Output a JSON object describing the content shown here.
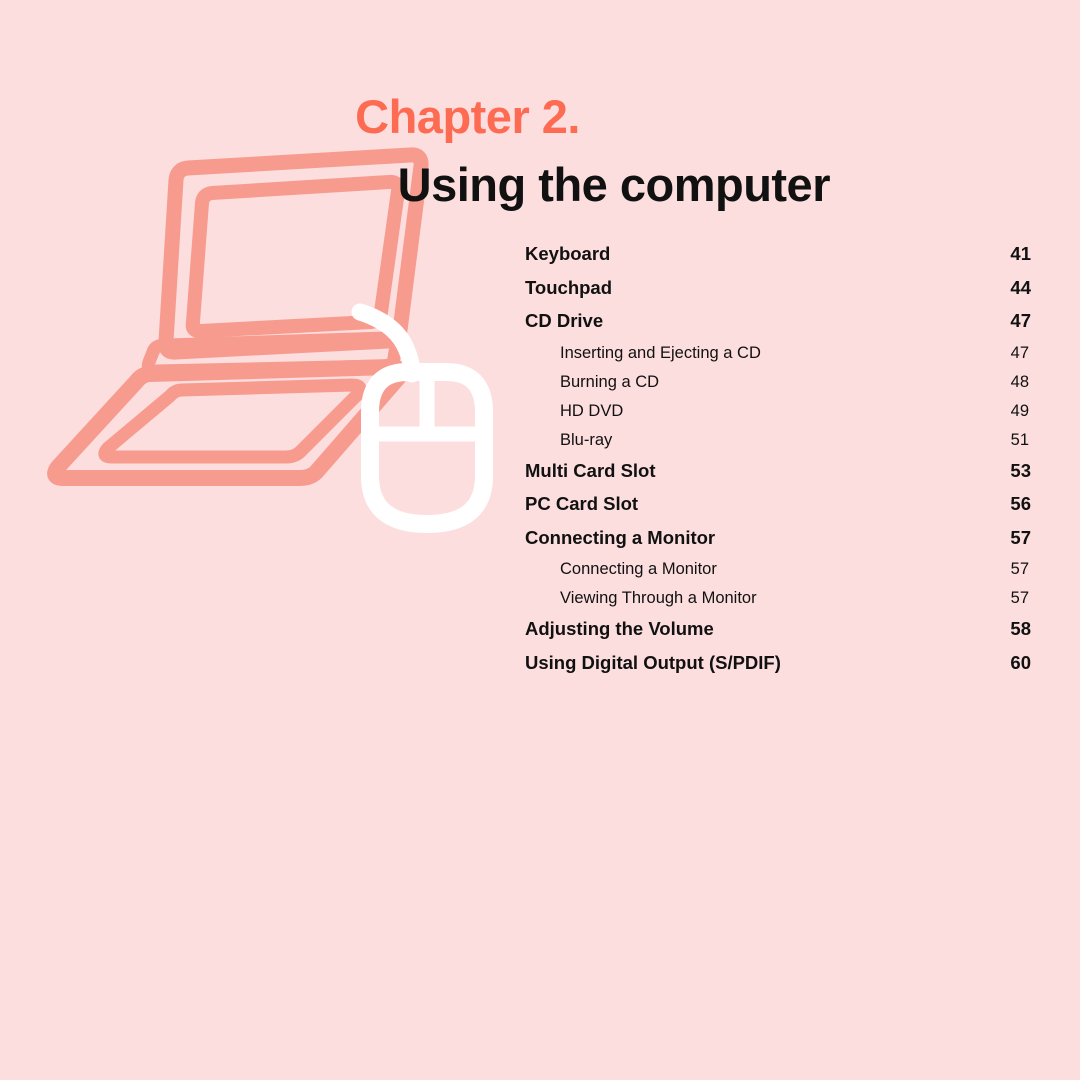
{
  "page": {
    "background_color": "#fddede",
    "accent_color": "#fc6b52",
    "illustration_color": "#f79b8e",
    "mouse_color": "#ffffff",
    "text_color": "#111111"
  },
  "header": {
    "chapter_label": "Chapter 2.",
    "chapter_title": "Using the computer"
  },
  "illustration": {
    "laptop_icon": "laptop-outline-icon",
    "mouse_icon": "computer-mouse-outline-icon"
  },
  "toc": {
    "entries": [
      {
        "label": "Keyboard",
        "page": "41",
        "level": 1
      },
      {
        "label": "Touchpad",
        "page": "44",
        "level": 1
      },
      {
        "label": "CD Drive",
        "page": "47",
        "level": 1
      },
      {
        "label": "Inserting and Ejecting a CD",
        "page": "47",
        "level": 2
      },
      {
        "label": "Burning a CD",
        "page": "48",
        "level": 2
      },
      {
        "label": "HD DVD",
        "page": "49",
        "level": 2
      },
      {
        "label": "Blu-ray",
        "page": "51",
        "level": 2
      },
      {
        "label": "Multi Card Slot",
        "page": "53",
        "level": 1
      },
      {
        "label": "PC Card Slot",
        "page": "56",
        "level": 1
      },
      {
        "label": "Connecting a Monitor",
        "page": "57",
        "level": 1
      },
      {
        "label": "Connecting a Monitor",
        "page": "57",
        "level": 2
      },
      {
        "label": "Viewing Through a Monitor",
        "page": "57",
        "level": 2
      },
      {
        "label": "Adjusting the Volume",
        "page": "58",
        "level": 1
      },
      {
        "label": "Using Digital Output (S/PDIF)",
        "page": "60",
        "level": 1
      }
    ]
  }
}
